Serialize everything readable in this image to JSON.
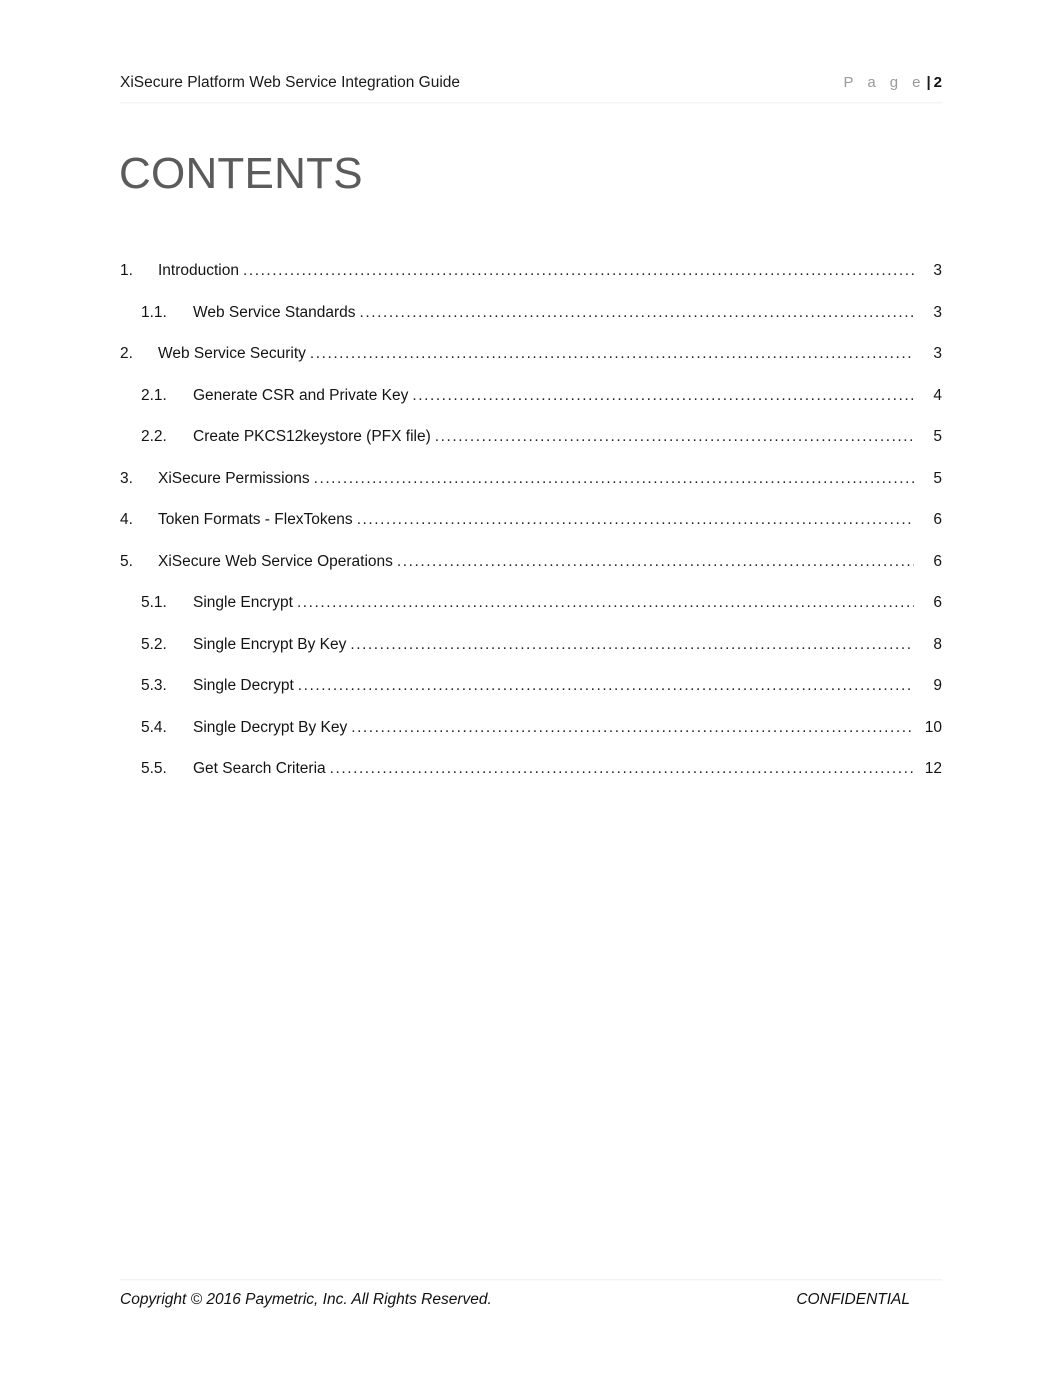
{
  "document": {
    "header": {
      "title": "XiSecure Platform Web Service Integration Guide",
      "page_label": "P a g e",
      "page_separator": "|",
      "page_number": "2"
    },
    "title": "CONTENTS",
    "toc": {
      "entries": [
        {
          "level": 1,
          "number": "1.",
          "text": "Introduction",
          "page": "3"
        },
        {
          "level": 2,
          "number": "1.1.",
          "text": "Web Service Standards",
          "page": "3"
        },
        {
          "level": 1,
          "number": "2.",
          "text": "Web Service Security",
          "page": "3"
        },
        {
          "level": 2,
          "number": "2.1.",
          "text": "Generate CSR and Private Key",
          "page": "4"
        },
        {
          "level": 2,
          "number": "2.2.",
          "text": "Create PKCS12keystore (PFX file)",
          "page": "5"
        },
        {
          "level": 1,
          "number": "3.",
          "text": "XiSecure Permissions",
          "page": "5"
        },
        {
          "level": 1,
          "number": "4.",
          "text": "Token Formats - FlexTokens",
          "page": "6"
        },
        {
          "level": 1,
          "number": "5.",
          "text": "XiSecure Web Service Operations",
          "page": "6"
        },
        {
          "level": 2,
          "number": "5.1.",
          "text": "Single Encrypt",
          "page": "6"
        },
        {
          "level": 2,
          "number": "5.2.",
          "text": "Single Encrypt By Key",
          "page": "8"
        },
        {
          "level": 2,
          "number": "5.3.",
          "text": "Single Decrypt",
          "page": "9"
        },
        {
          "level": 2,
          "number": "5.4.",
          "text": "Single Decrypt By Key",
          "page": "10"
        },
        {
          "level": 2,
          "number": "5.5.",
          "text": "Get Search Criteria",
          "page": "12"
        }
      ]
    },
    "footer": {
      "copyright": "Copyright © 2016 Paymetric, Inc. All Rights Reserved.",
      "classification": "CONFIDENTIAL"
    },
    "colors": {
      "body_text": "#141414",
      "title_gray": "#5b5b5b",
      "page_label_gray": "#9a9a9a",
      "rule_gray": "#f4f4f4",
      "background": "#ffffff"
    }
  }
}
